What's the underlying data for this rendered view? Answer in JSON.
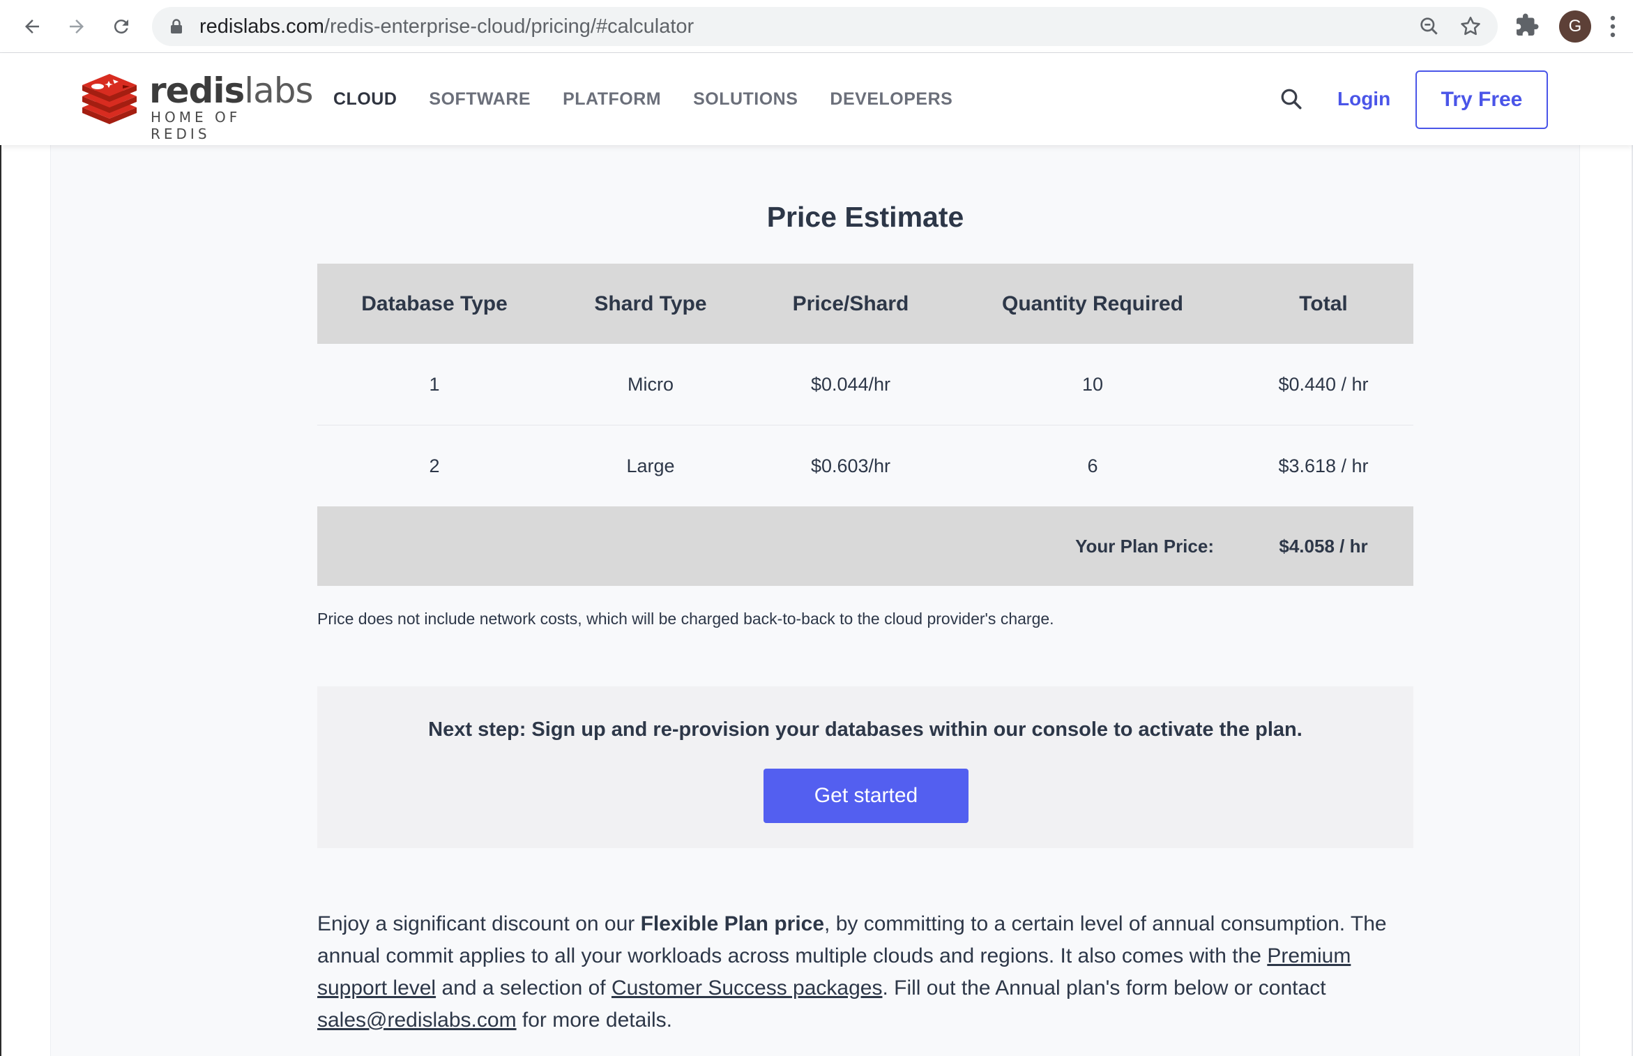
{
  "browser": {
    "url_domain": "redislabs.com",
    "url_path": "/redis-enterprise-cloud/pricing/#calculator",
    "avatar_letter": "G"
  },
  "header": {
    "logo_bold": "redis",
    "logo_light": "labs",
    "logo_tagline": "HOME OF REDIS",
    "nav": [
      "CLOUD",
      "SOFTWARE",
      "PLATFORM",
      "SOLUTIONS",
      "DEVELOPERS"
    ],
    "login": "Login",
    "try_free": "Try Free"
  },
  "estimate": {
    "title": "Price Estimate",
    "columns": [
      "Database Type",
      "Shard Type",
      "Price/Shard",
      "Quantity Required",
      "Total"
    ],
    "rows": [
      [
        "1",
        "Micro",
        "$0.044/hr",
        "10",
        "$0.440 / hr"
      ],
      [
        "2",
        "Large",
        "$0.603/hr",
        "6",
        "$3.618 / hr"
      ]
    ],
    "plan_label": "Your Plan Price:",
    "plan_total": "$4.058 / hr",
    "note": "Price does not include network costs, which will be charged back-to-back to the cloud provider's charge."
  },
  "next_step": {
    "text": "Next step: Sign up and re-provision your databases within our console to activate the plan.",
    "button": "Get started"
  },
  "discount": {
    "p1": "Enjoy a significant discount on our ",
    "p1_bold": "Flexible Plan price",
    "p2": ", by committing to a certain level of annual consumption. The annual commit applies to all your workloads across multiple clouds and regions. It also comes with the ",
    "link_premium": "Premium support level",
    "p3": " and a selection of ",
    "link_cs": "Customer Success packages",
    "p4": ". Fill out the Annual plan's form below or contact ",
    "link_email": "sales@redislabs.com",
    "p5": " for more details."
  },
  "colors": {
    "accent": "#4a55e8",
    "button": "#535ff0",
    "logo_red": "#c6302b"
  }
}
